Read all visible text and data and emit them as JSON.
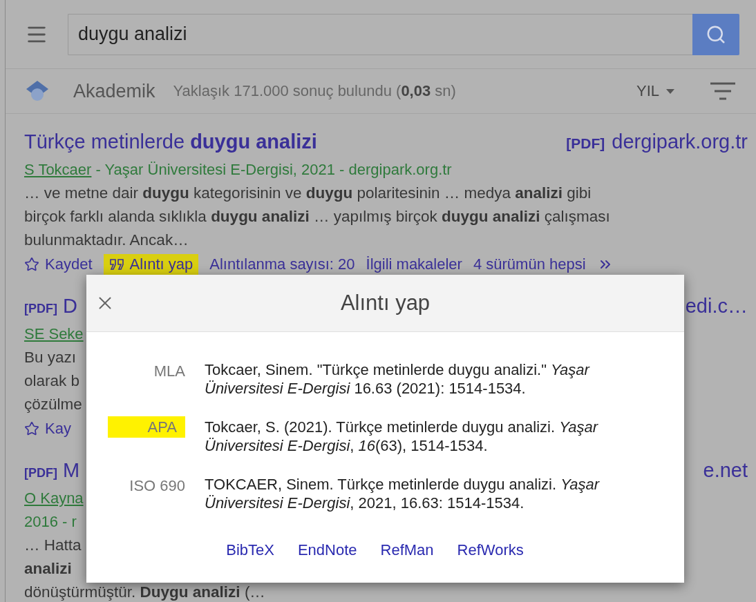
{
  "search": {
    "value": "duygu analizi"
  },
  "header": {
    "brand": "Akademik",
    "result_count": "Yaklaşık 171.000 sonuç bulundu (**0,03** sn)",
    "year_filter": "YIL"
  },
  "results": [
    {
      "title": "Türkçe metinlerde **duygu analizi**",
      "source_tag": "[PDF]",
      "source": "dergipark.org.tr",
      "author": "S Tokcaer",
      "meta": " - Yaşar Üniversitesi E-Dergisi, 2021 - dergipark.org.tr",
      "snippet_lines": [
        "… ve metne dair **duygu** kategorisinin ve **duygu** polaritesinin … medya **analizi** gibi",
        "birçok farklı alanda sıklıkla **duygu analizi** … yapılmış birçok **duygu analizi** çalışması",
        "bulunmaktadır. Ancak…"
      ],
      "actions": [
        {
          "kind": "save",
          "label": "Kaydet",
          "highlighted": false
        },
        {
          "kind": "cite",
          "label": "Alıntı yap",
          "highlighted": true
        },
        {
          "kind": "link",
          "label": "Alıntılanma sayısı: 20",
          "highlighted": false
        },
        {
          "kind": "link",
          "label": "İlgili makaleler",
          "highlighted": false
        },
        {
          "kind": "link",
          "label": "4 sürümün hepsi",
          "highlighted": false
        },
        {
          "kind": "more",
          "highlighted": false
        }
      ]
    },
    {
      "title_tag": "[PDF]",
      "title": "D",
      "source": "edi.c…",
      "author": "SE Seke",
      "snippet_lines": [
        "Bu yazı",
        "olarak b",
        "çözülme"
      ],
      "actions": [
        {
          "kind": "save",
          "label": "Kay",
          "highlighted": false
        }
      ]
    },
    {
      "title_tag": "[PDF]",
      "title": "M",
      "source": "e.net",
      "author": "O Kayna",
      "meta_lines": [
        "2016 - r"
      ],
      "snippet_lines": [
        "… Hatta",
        "**analizi**",
        "dönüştürmüştür. **Duygu analizi** (…"
      ]
    }
  ],
  "cite_dialog": {
    "title": "Alıntı yap",
    "citations": [
      {
        "label": "MLA",
        "text": "Tokcaer, Sinem. \"Türkçe metinlerde duygu analizi.\" *Yaşar Üniversitesi E-Dergisi* 16.63 (2021): 1514-1534.",
        "highlighted": false
      },
      {
        "label": "APA",
        "text": "Tokcaer, S. (2021). Türkçe metinlerde duygu analizi. *Yaşar Üniversitesi E-Dergisi*, *16*(63), 1514-1534.",
        "highlighted": true
      },
      {
        "label": "ISO 690",
        "text": "TOKCAER, Sinem. Türkçe metinlerde duygu analizi. *Yaşar Üniversitesi E-Dergisi*, 2021, 16.63: 1514-1534.",
        "highlighted": false
      }
    ],
    "exports": [
      "BibTeX",
      "EndNote",
      "RefMan",
      "RefWorks"
    ]
  }
}
